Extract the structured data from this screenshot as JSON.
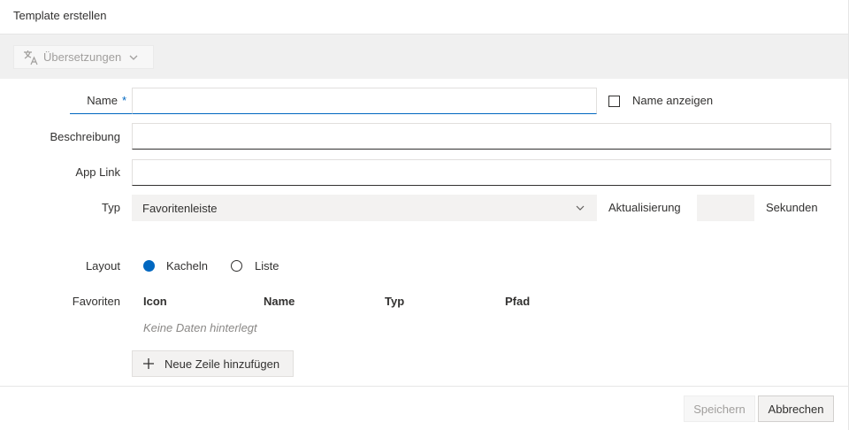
{
  "dialog": {
    "title": "Template erstellen"
  },
  "toolbar": {
    "translations_label": "Übersetzungen"
  },
  "form": {
    "name_label": "Name",
    "required_mark": "*",
    "name_value": "",
    "show_name_label": "Name anzeigen",
    "show_name_checked": false,
    "description_label": "Beschreibung",
    "description_value": "",
    "applink_label": "App Link",
    "applink_value": "",
    "type_label": "Typ",
    "type_value": "Favoritenleiste",
    "refresh_label": "Aktualisierung",
    "refresh_value": "",
    "seconds_label": "Sekunden",
    "layout_label": "Layout",
    "layout_options": [
      "Kacheln",
      "Liste"
    ],
    "layout_selected": "Kacheln",
    "favorites_label": "Favoriten",
    "favorites_columns": [
      "Icon",
      "Name",
      "Typ",
      "Pfad"
    ],
    "favorites_empty": "Keine Daten hinterlegt",
    "add_row_label": "Neue Zeile hinzufügen"
  },
  "footer": {
    "save_label": "Speichern",
    "cancel_label": "Abbrechen"
  },
  "colors": {
    "accent": "#0067c0",
    "toolbar_bg": "#f0f0f0",
    "input_bg": "#f3f2f1"
  },
  "icons": {
    "translate": "translate-icon",
    "chevron": "chevron-down-icon",
    "plus": "plus-icon"
  }
}
